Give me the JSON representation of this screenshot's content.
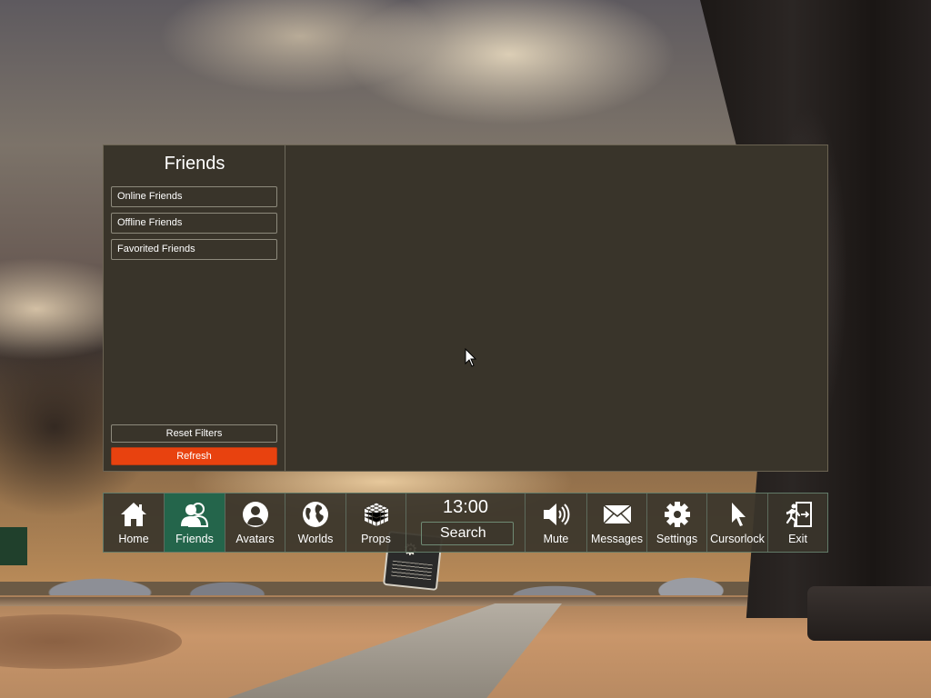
{
  "panel": {
    "title": "Friends",
    "filters": [
      {
        "label": "Online Friends"
      },
      {
        "label": "Offline Friends"
      },
      {
        "label": "Favorited Friends"
      }
    ],
    "reset_label": "Reset Filters",
    "refresh_label": "Refresh"
  },
  "toolbar": {
    "items": [
      {
        "label": "Home",
        "icon": "home-icon"
      },
      {
        "label": "Friends",
        "icon": "friends-icon",
        "active": true
      },
      {
        "label": "Avatars",
        "icon": "avatar-icon"
      },
      {
        "label": "Worlds",
        "icon": "globe-icon"
      },
      {
        "label": "Props",
        "icon": "cube-icon"
      },
      {
        "label": "Mute",
        "icon": "speaker-icon"
      },
      {
        "label": "Messages",
        "icon": "envelope-icon"
      },
      {
        "label": "Settings",
        "icon": "gear-icon"
      },
      {
        "label": "Cursorlock",
        "icon": "cursor-icon"
      },
      {
        "label": "Exit",
        "icon": "exit-icon"
      }
    ],
    "clock": "13:00",
    "search_label": "Search"
  },
  "colors": {
    "panel_bg": "#39342a",
    "active_tab": "#24654b",
    "refresh": "#e8420f",
    "toolbar_border": "#627a68"
  }
}
